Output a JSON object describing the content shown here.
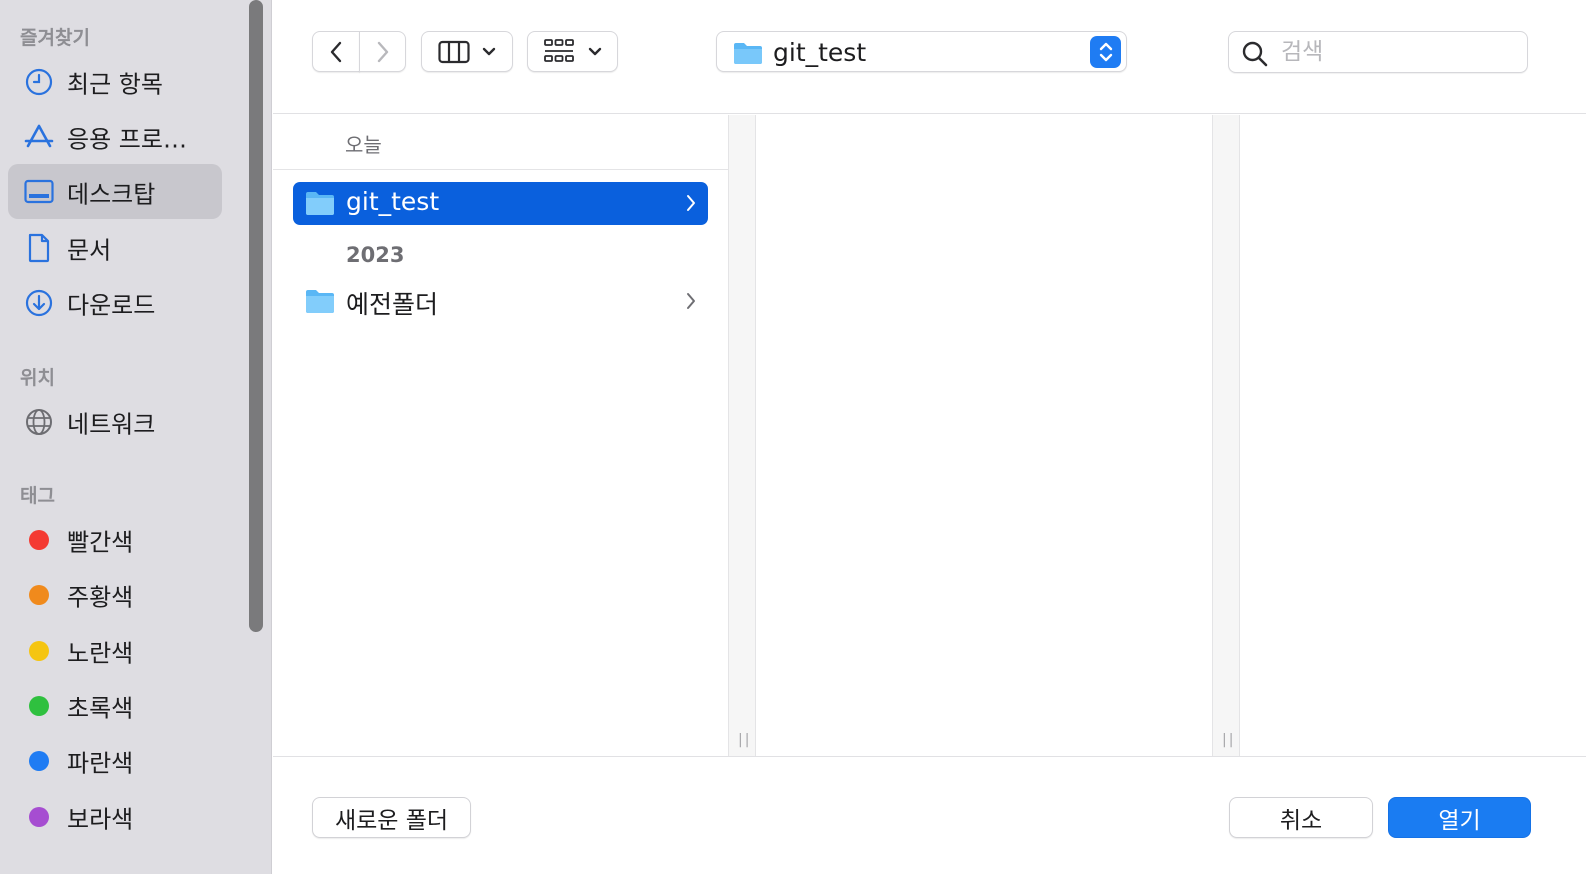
{
  "colors": {
    "accent": "#1a7cf2",
    "selection": "#0a60dd",
    "folder": "#5ab7f5",
    "sidebar_icon": "#2a72de"
  },
  "sidebar": {
    "favorites_title": "즐겨찾기",
    "favorites": [
      {
        "label": "최근 항목",
        "icon": "clock-icon"
      },
      {
        "label": "응용 프로…",
        "icon": "app-store-icon"
      },
      {
        "label": "데스크탑",
        "icon": "desktop-icon",
        "selected": true
      },
      {
        "label": "문서",
        "icon": "document-icon"
      },
      {
        "label": "다운로드",
        "icon": "download-icon"
      }
    ],
    "locations_title": "위치",
    "locations": [
      {
        "label": "네트워크",
        "icon": "globe-icon"
      }
    ],
    "tags_title": "태그",
    "tags": [
      {
        "label": "빨간색",
        "color": "#f43a32"
      },
      {
        "label": "주황색",
        "color": "#f08a1c"
      },
      {
        "label": "노란색",
        "color": "#f5c511"
      },
      {
        "label": "초록색",
        "color": "#2fc03f"
      },
      {
        "label": "파란색",
        "color": "#1f7cf3"
      },
      {
        "label": "보라색",
        "color": "#a64dd1"
      }
    ]
  },
  "toolbar": {
    "back_icon": "chevron-left-icon",
    "forward_icon": "chevron-right-icon",
    "view_icon": "column-view-icon",
    "group_icon": "grid-group-icon",
    "path_label": "git_test",
    "search_placeholder": "검색"
  },
  "browser": {
    "column1": {
      "groups": [
        {
          "title": "오늘",
          "items": [
            {
              "label": "git_test",
              "selected": true
            }
          ]
        },
        {
          "title": "2023",
          "items": [
            {
              "label": "예전폴더",
              "selected": false
            }
          ]
        }
      ]
    },
    "divider_grip": "||"
  },
  "footer": {
    "new_folder_label": "새로운 폴더",
    "cancel_label": "취소",
    "open_label": "열기"
  }
}
